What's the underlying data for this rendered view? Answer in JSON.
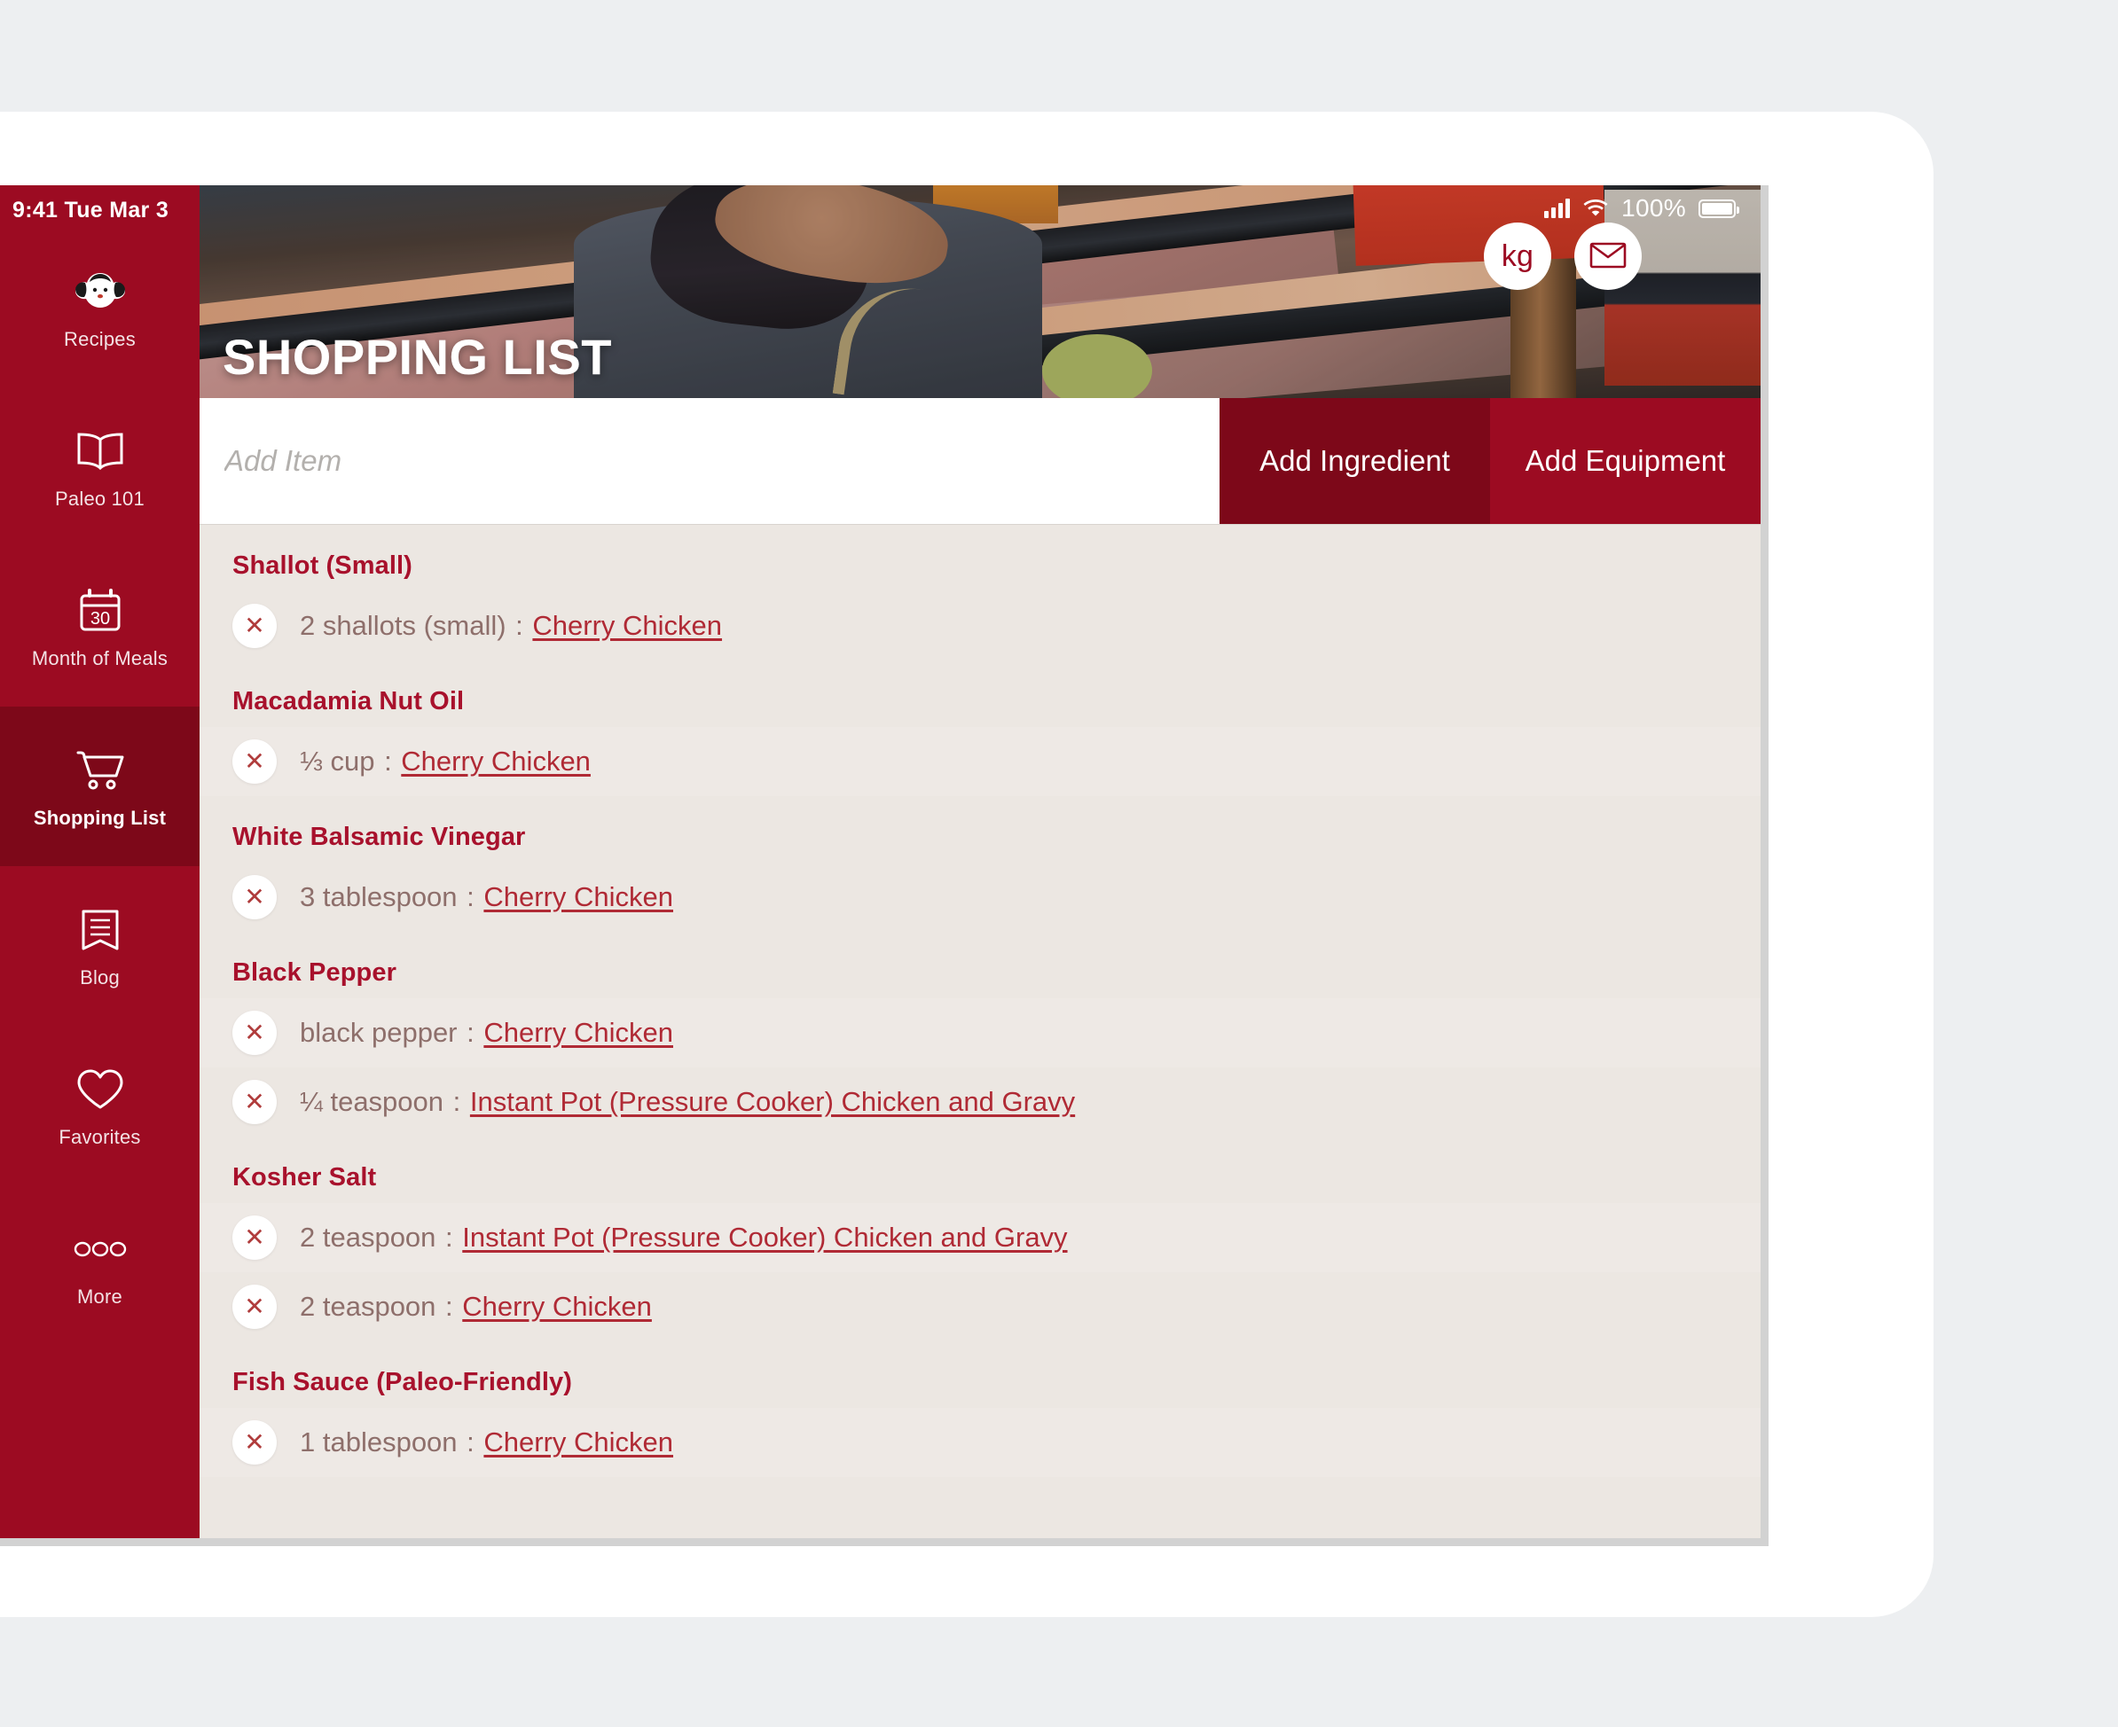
{
  "statusbar": {
    "time_date": "9:41  Tue Mar 3",
    "battery_percent": "100%",
    "signal_icon": "cellular-signal-icon",
    "wifi_icon": "wifi-icon",
    "battery_icon": "battery-full-icon"
  },
  "sidebar": {
    "items": [
      {
        "label": "Recipes",
        "icon": "nom-nom-paleo-girl-logo-icon",
        "active": false
      },
      {
        "label": "Paleo 101",
        "icon": "open-book-icon",
        "active": false
      },
      {
        "label": "Month of Meals",
        "icon": "calendar-30-icon",
        "active": false
      },
      {
        "label": "Shopping List",
        "icon": "shopping-cart-icon",
        "active": true
      },
      {
        "label": "Blog",
        "icon": "bookmark-lines-icon",
        "active": false
      },
      {
        "label": "Favorites",
        "icon": "heart-icon",
        "active": false
      },
      {
        "label": "More",
        "icon": "three-circles-icon",
        "active": false
      }
    ]
  },
  "hero": {
    "title": "SHOPPING LIST",
    "unit_toggle_label": "kg",
    "unit_toggle_icon": "weight-unit-icon",
    "email_icon": "envelope-icon"
  },
  "addbar": {
    "input_placeholder": "Add Item",
    "input_value": "",
    "add_ingredient_label": "Add Ingredient",
    "add_equipment_label": "Add Equipment"
  },
  "colors": {
    "brand_red": "#9c0b22",
    "brand_red_dark": "#7d0819",
    "heading_red": "#a8112c",
    "link_red": "#b02a35",
    "list_bg": "#ece7e2",
    "page_bg": "#edeff1"
  },
  "list": {
    "delete_icon": "close-x-icon",
    "groups": [
      {
        "name": "Shallot (Small)",
        "rows": [
          {
            "qty": "2 shallots (small)",
            "sep": ":",
            "recipe": "Cherry Chicken"
          }
        ]
      },
      {
        "name": "Macadamia Nut Oil",
        "rows": [
          {
            "qty": "⅓ cup",
            "sep": ":",
            "recipe": "Cherry Chicken"
          }
        ]
      },
      {
        "name": "White Balsamic Vinegar",
        "rows": [
          {
            "qty": "3 tablespoon",
            "sep": ":",
            "recipe": "Cherry Chicken"
          }
        ]
      },
      {
        "name": "Black Pepper",
        "rows": [
          {
            "qty": "black pepper",
            "sep": ":",
            "recipe": "Cherry Chicken"
          },
          {
            "qty": "¼ teaspoon",
            "sep": ":",
            "recipe": "Instant Pot (Pressure Cooker) Chicken and Gravy"
          }
        ]
      },
      {
        "name": "Kosher Salt",
        "rows": [
          {
            "qty": "2 teaspoon",
            "sep": ":",
            "recipe": "Instant Pot (Pressure Cooker) Chicken and Gravy"
          },
          {
            "qty": "2 teaspoon",
            "sep": ":",
            "recipe": "Cherry Chicken"
          }
        ]
      },
      {
        "name": "Fish Sauce (Paleo-Friendly)",
        "rows": [
          {
            "qty": "1 tablespoon",
            "sep": ":",
            "recipe": "Cherry Chicken"
          }
        ]
      }
    ]
  }
}
